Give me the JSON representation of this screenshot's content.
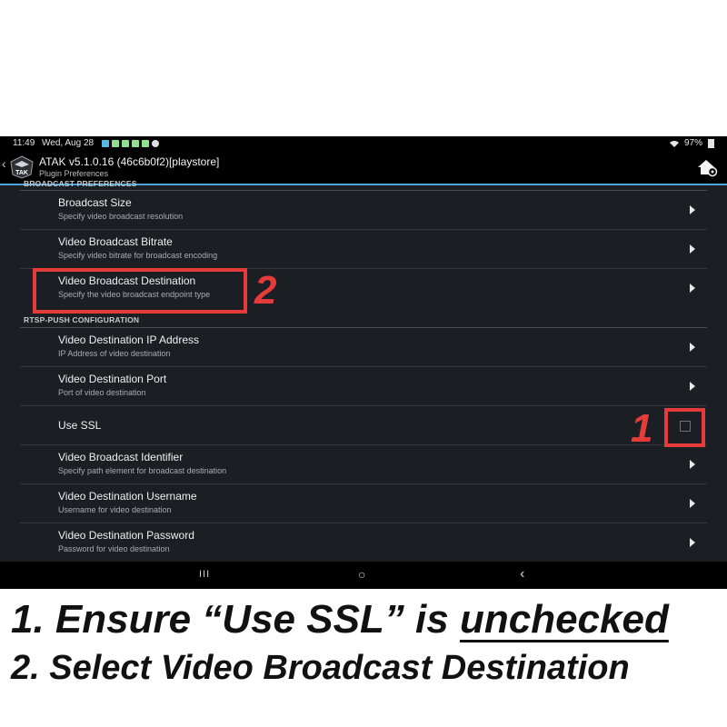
{
  "status_bar": {
    "time": "11:49",
    "date": "Wed, Aug 28",
    "battery": "97%",
    "notification_colors": [
      "#5bb7e6",
      "#8fe08f",
      "#8fe08f",
      "#8fe08f",
      "#8fe08f",
      "#e0e0e0"
    ]
  },
  "app_bar": {
    "title": "ATAK v5.1.0.16 (46c6b0f2)[playstore]",
    "subtitle": "Plugin Preferences",
    "logo_text": "TAK",
    "back_icon": "chevron-left-icon",
    "home_icon": "home-settings-icon"
  },
  "sections": [
    {
      "header": "BROADCAST PREFERENCES",
      "items": [
        {
          "title": "Broadcast Size",
          "summary": "Specify video broadcast resolution",
          "widget": "chevron"
        },
        {
          "title": "Video Broadcast Bitrate",
          "summary": "Specify video bitrate for broadcast encoding",
          "widget": "chevron"
        },
        {
          "title": "Video Broadcast Destination",
          "summary": "Specify the video broadcast endpoint type",
          "widget": "chevron"
        }
      ]
    },
    {
      "header": "RTSP-PUSH CONFIGURATION",
      "items": [
        {
          "title": "Video Destination IP Address",
          "summary": "IP Address of video destination",
          "widget": "chevron"
        },
        {
          "title": "Video Destination Port",
          "summary": "Port of video destination",
          "widget": "chevron"
        },
        {
          "title": "Use SSL",
          "summary": "",
          "widget": "checkbox",
          "checked": false
        },
        {
          "title": "Video Broadcast Identifier",
          "summary": "Specify path element for broadcast destination",
          "widget": "chevron"
        },
        {
          "title": "Video Destination Username",
          "summary": "Username for video destination",
          "widget": "chevron"
        },
        {
          "title": "Video Destination Password",
          "summary": "Password for video destination",
          "widget": "chevron"
        }
      ]
    }
  ],
  "nav_bar": {
    "recents": "III",
    "home": "○",
    "back": "‹"
  },
  "callouts": {
    "one": "1",
    "two": "2",
    "color": "#e53b3b"
  },
  "instructions": {
    "line1_prefix": "1.  Ensure “Use SSL” is ",
    "line1_emphasis": "unchecked",
    "line2": "2.  Select Video Broadcast Destination"
  },
  "colors": {
    "accent": "#4aa3d8",
    "background": "#1b1e22"
  }
}
